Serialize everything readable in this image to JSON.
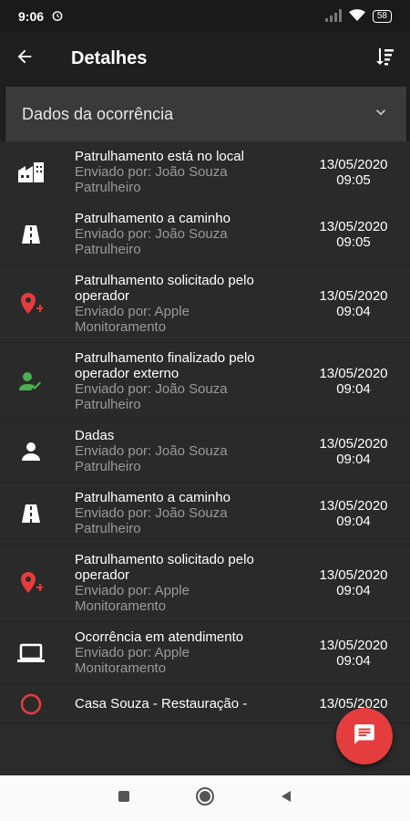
{
  "status": {
    "time": "9:06",
    "battery": "58"
  },
  "header": {
    "title": "Detalhes"
  },
  "section": {
    "label": "Dados da ocorrência"
  },
  "items": [
    {
      "icon": "building",
      "title": "Patrulhamento está no local",
      "subtitle": "Enviado por: João Souza\nPatrulheiro",
      "date": "13/05/2020",
      "time": "09:05"
    },
    {
      "icon": "road",
      "title": "Patrulhamento a caminho",
      "subtitle": "Enviado por: João Souza\nPatrulheiro",
      "date": "13/05/2020",
      "time": "09:05"
    },
    {
      "icon": "pin-add",
      "title": "Patrulhamento solicitado pelo operador",
      "subtitle": "Enviado por: Apple\nMonitoramento",
      "date": "13/05/2020",
      "time": "09:04"
    },
    {
      "icon": "person-check",
      "title": "Patrulhamento finalizado pelo operador externo",
      "subtitle": "Enviado por: João Souza\nPatrulheiro",
      "date": "13/05/2020",
      "time": "09:04"
    },
    {
      "icon": "person",
      "title": "Dadas",
      "subtitle": "Enviado por: João Souza\nPatrulheiro",
      "date": "13/05/2020",
      "time": "09:04"
    },
    {
      "icon": "road",
      "title": "Patrulhamento a caminho",
      "subtitle": "Enviado por: João Souza\nPatrulheiro",
      "date": "13/05/2020",
      "time": "09:04"
    },
    {
      "icon": "pin-add",
      "title": "Patrulhamento solicitado pelo operador",
      "subtitle": "Enviado por: Apple\nMonitoramento",
      "date": "13/05/2020",
      "time": "09:04"
    },
    {
      "icon": "laptop",
      "title": "Ocorrência em atendimento",
      "subtitle": "Enviado por: Apple\nMonitoramento",
      "date": "13/05/2020",
      "time": "09:04"
    },
    {
      "icon": "alarm",
      "title": "Casa Souza - Restauração -",
      "subtitle": "",
      "date": "13/05/2020",
      "time": ""
    }
  ],
  "colors": {
    "accent": "#e53d3d",
    "success": "#4caf50"
  }
}
